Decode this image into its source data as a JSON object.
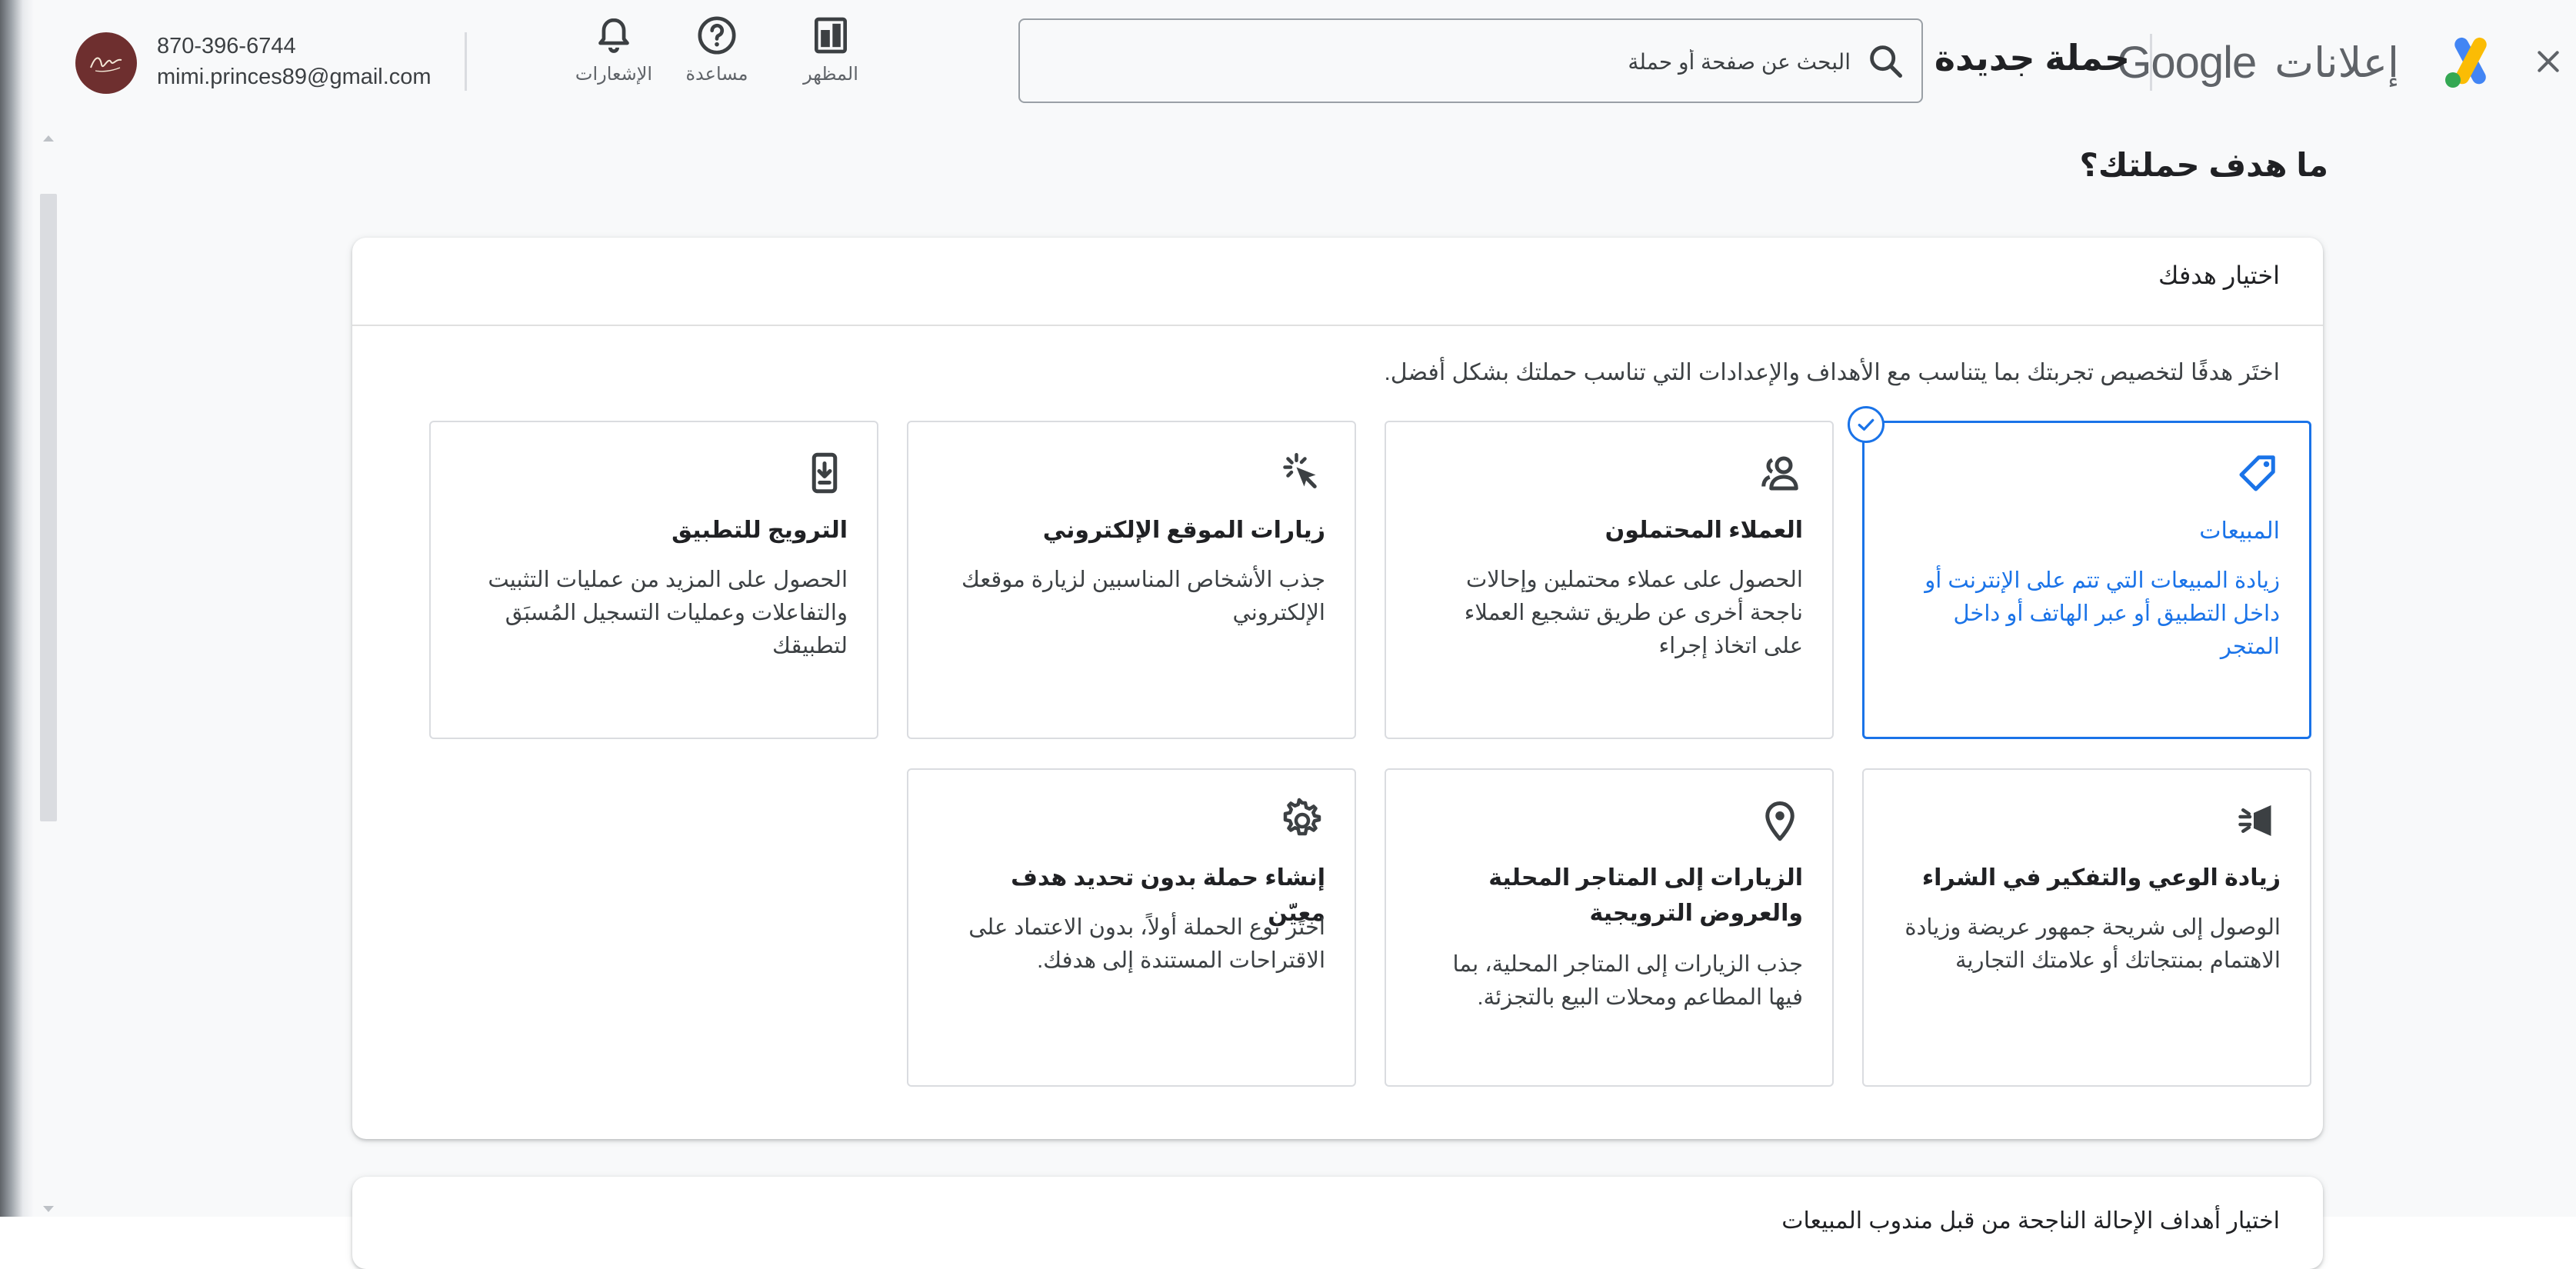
{
  "header": {
    "close_icon": "close-icon",
    "brand_google": "Google",
    "brand_product": "إعلانات",
    "page_title": "حملة جديدة",
    "search_placeholder": "البحث عن صفحة أو حملة",
    "tools": [
      {
        "label": "المظهر",
        "icon": "appearance-icon"
      },
      {
        "label": "مساعدة",
        "icon": "help-icon"
      },
      {
        "label": "الإشعارات",
        "icon": "bell-icon"
      }
    ],
    "account": {
      "phone": "870-396-6744",
      "email": "mimi.princes89@gmail.com",
      "avatar_color": "#6e2f2f"
    }
  },
  "main": {
    "question": "ما هدف حملتك؟",
    "card_title": "اختيار هدفك",
    "instruction": "اختَر هدفًا لتخصيص تجربتك بما يتناسب مع الأهداف والإعدادات التي تناسب حملتك بشكل أفضل.",
    "goals": [
      {
        "title": "المبيعات",
        "desc": "زيادة المبيعات التي تتم على الإنترنت أو داخل التطبيق أو عبر الهاتف أو داخل المتجر",
        "icon": "tag-icon",
        "selected": true
      },
      {
        "title": "العملاء المحتملون",
        "desc": "الحصول على عملاء محتملين وإحالات ناجحة أخرى عن طريق تشجيع العملاء على اتخاذ إجراء",
        "icon": "people-icon",
        "selected": false
      },
      {
        "title": "زيارات الموقع الإلكتروني",
        "desc": "جذب الأشخاص المناسبين لزيارة موقعك الإلكتروني",
        "icon": "cursor-click-icon",
        "selected": false
      },
      {
        "title": "الترويج للتطبيق",
        "desc": "الحصول على المزيد من عمليات التثبيت والتفاعلات وعمليات التسجيل المُسبَق لتطبيقك",
        "icon": "phone-download-icon",
        "selected": false
      },
      {
        "title": "زيادة الوعي والتفكير في الشراء",
        "desc": "الوصول إلى شريحة جمهور عريضة وزيادة الاهتمام بمنتجاتك أو علامتك التجارية",
        "icon": "megaphone-icon",
        "selected": false
      },
      {
        "title": "الزيارات إلى المتاجر المحلية والعروض الترويجية",
        "desc": "جذب الزيارات إلى المتاجر المحلية، بما فيها المطاعم ومحلات البيع بالتجزئة.",
        "icon": "location-pin-icon",
        "selected": false
      },
      {
        "title": "إنشاء حملة بدون تحديد هدف معيّن",
        "desc": "اختَر نوع الحملة أولاً، بدون الاعتماد على الاقتراحات المستندة إلى هدفك.",
        "icon": "gear-icon",
        "selected": false
      }
    ],
    "next_section_peek": "اختيار أهداف الإحالة الناجحة من قبل مندوب المبيعات"
  },
  "colors": {
    "accent": "#1a73e8",
    "background": "#f8f9fa",
    "card": "#ffffff",
    "border": "#dadce0",
    "text": "#202124",
    "secondary_text": "#3c4043"
  }
}
